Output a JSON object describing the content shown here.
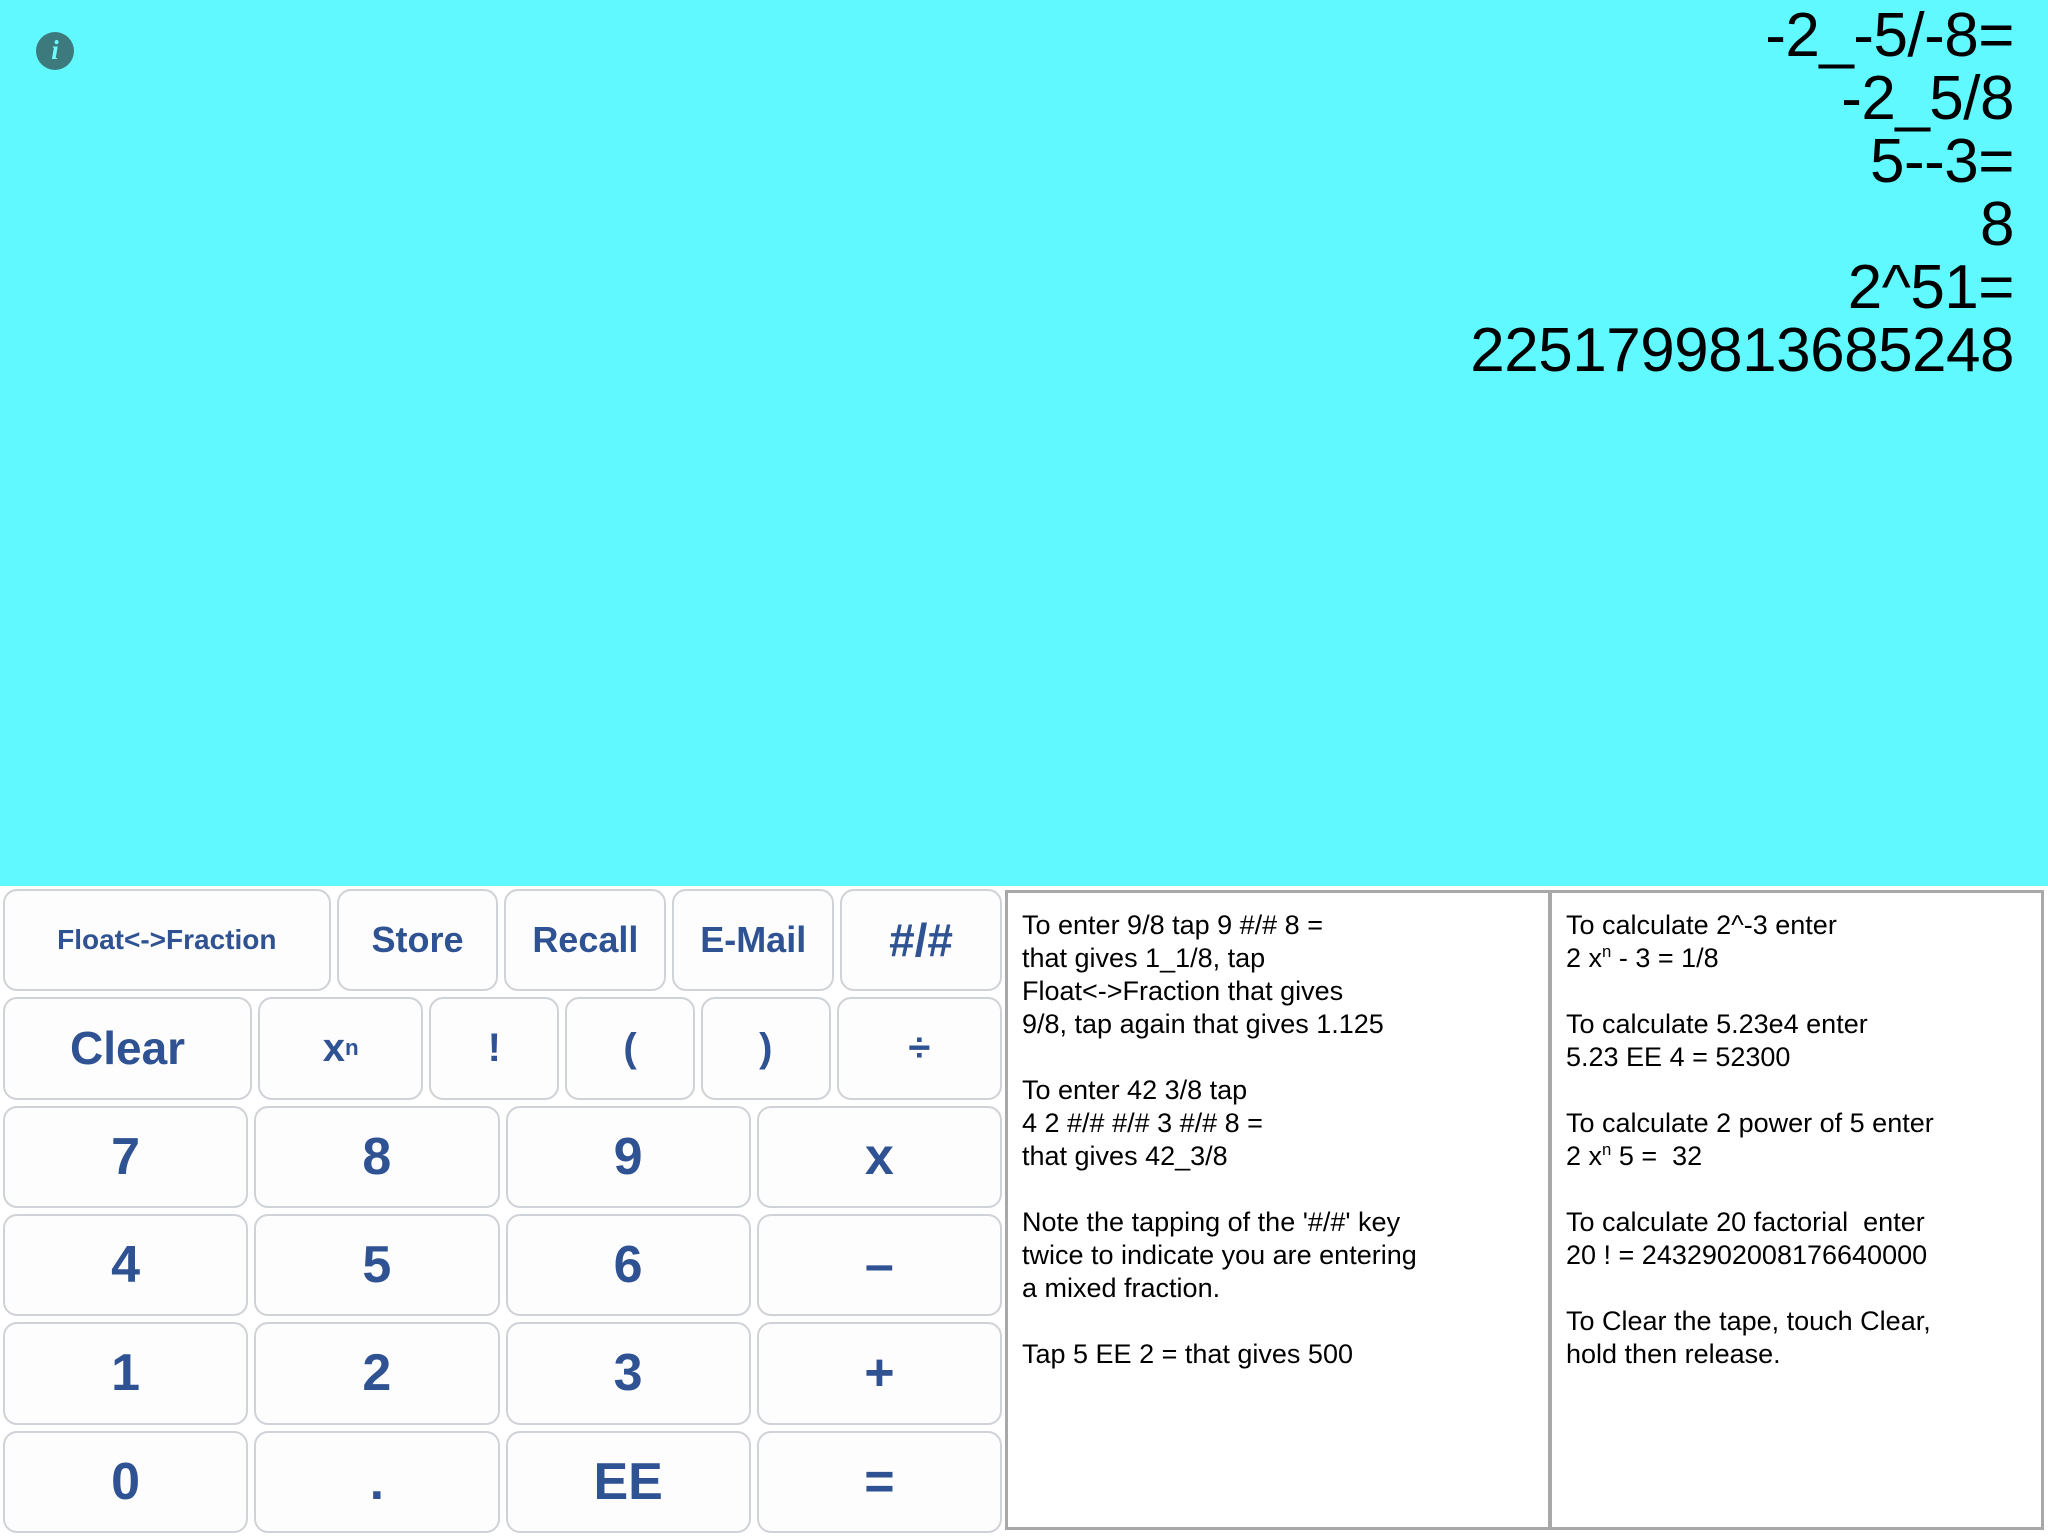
{
  "display": {
    "background_color": "#5ff9ff",
    "info_icon": "info-icon",
    "tape_lines": [
      "-2_-5/-8=",
      "-2_5/8",
      "5--3=",
      "8",
      "2^51=",
      "2251799813685248"
    ]
  },
  "keypad": {
    "text_color": "#2f5293",
    "rows": [
      [
        {
          "label": "Float<->Fraction",
          "name": "float-fraction-key"
        },
        {
          "label": "Store",
          "name": "store-key"
        },
        {
          "label": "Recall",
          "name": "recall-key"
        },
        {
          "label": "E-Mail",
          "name": "email-key"
        },
        {
          "label": "#/#",
          "name": "mixed-fraction-key"
        }
      ],
      [
        {
          "label": "Clear",
          "name": "clear-key"
        },
        {
          "label": "x",
          "sup": "n",
          "name": "power-key"
        },
        {
          "label": "!",
          "name": "factorial-key"
        },
        {
          "label": "(",
          "name": "open-paren-key"
        },
        {
          "label": ")",
          "name": "close-paren-key"
        },
        {
          "label": "÷",
          "name": "divide-key"
        }
      ],
      [
        {
          "label": "7",
          "name": "digit-7-key"
        },
        {
          "label": "8",
          "name": "digit-8-key"
        },
        {
          "label": "9",
          "name": "digit-9-key"
        },
        {
          "label": "x",
          "name": "multiply-key"
        }
      ],
      [
        {
          "label": "4",
          "name": "digit-4-key"
        },
        {
          "label": "5",
          "name": "digit-5-key"
        },
        {
          "label": "6",
          "name": "digit-6-key"
        },
        {
          "label": "–",
          "name": "minus-key"
        }
      ],
      [
        {
          "label": "1",
          "name": "digit-1-key"
        },
        {
          "label": "2",
          "name": "digit-2-key"
        },
        {
          "label": "3",
          "name": "digit-3-key"
        },
        {
          "label": "+",
          "name": "plus-key"
        }
      ],
      [
        {
          "label": "0",
          "name": "digit-0-key"
        },
        {
          "label": ".",
          "name": "decimal-point-key"
        },
        {
          "label": "EE",
          "name": "exponent-key"
        },
        {
          "label": "=",
          "name": "equals-key"
        }
      ]
    ]
  },
  "help": {
    "middle_column": [
      "To enter 9/8 tap 9 #/# 8 =\nthat gives 1_1/8, tap\nFloat<->Fraction that gives\n9/8, tap again that gives 1.125",
      "To enter 42 3/8 tap\n4 2 #/# #/# 3 #/# 8 =\nthat gives 42_3/8",
      "Note the tapping of the '#/#' key\ntwice to indicate you are entering\na mixed fraction.",
      "Tap 5 EE 2 = that gives 500"
    ],
    "right_column": [
      {
        "line1": "To calculate 2^-3 enter",
        "pre": "2 x",
        "sup": "n",
        "post": " - 3 = 1/8"
      },
      {
        "line1": "To calculate 5.23e4 enter",
        "pre": "5.23 EE 4 = 52300",
        "sup": "",
        "post": ""
      },
      {
        "line1": "To calculate 2 power of 5 enter",
        "pre": "2 x",
        "sup": "n",
        "post": " 5 =  32"
      },
      {
        "line1": "To calculate 20 factorial  enter",
        "pre": "20 ! = 2432902008176640000",
        "sup": "",
        "post": ""
      },
      {
        "line1": "To Clear the tape, touch Clear,",
        "pre": "hold then release.",
        "sup": "",
        "post": ""
      }
    ]
  }
}
